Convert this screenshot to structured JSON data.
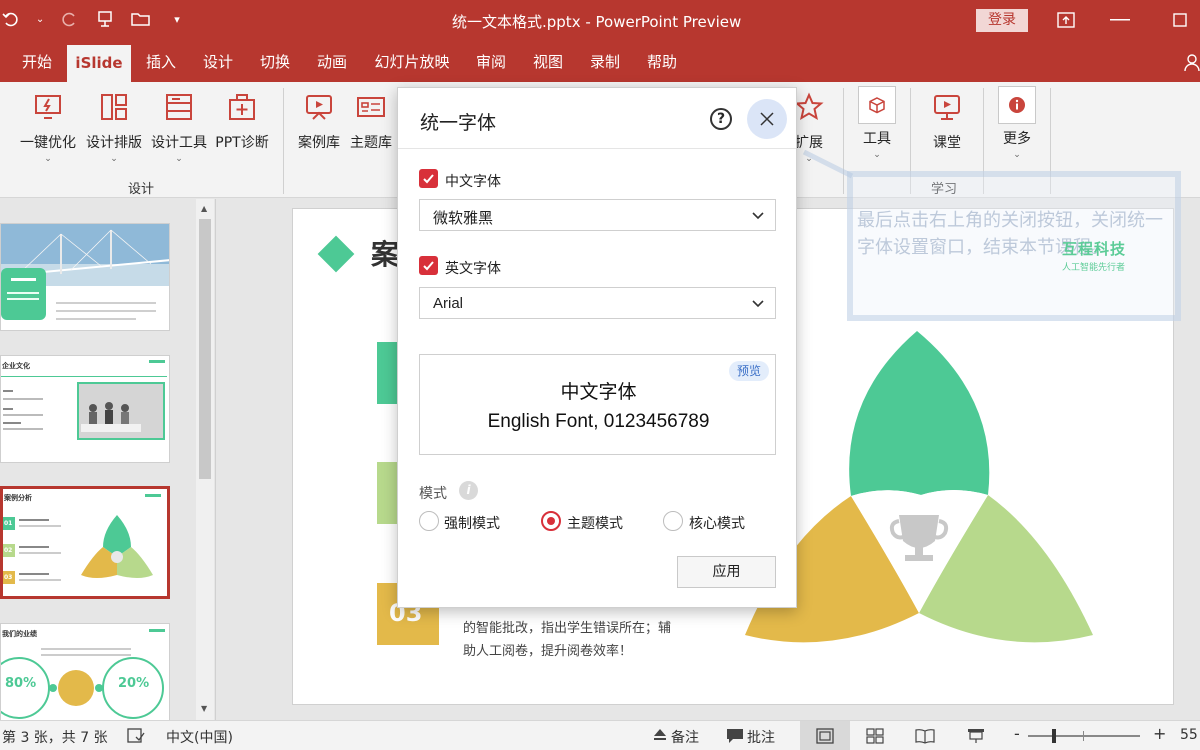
{
  "window": {
    "title": "统一文本格式.pptx  -  PowerPoint Preview",
    "login_label": "登录"
  },
  "menu": {
    "tabs": [
      "开始",
      "iSlide",
      "插入",
      "设计",
      "切换",
      "动画",
      "幻灯片放映",
      "审阅",
      "视图",
      "录制",
      "帮助"
    ],
    "active": "iSlide"
  },
  "ribbon": {
    "design_group": {
      "label": "设计",
      "buttons": [
        "一键优化",
        "设计排版",
        "设计工具",
        "PPT诊断"
      ]
    },
    "resource_buttons": [
      "案例库",
      "主题库"
    ],
    "extend_label": "扩展",
    "tools_label": "工具",
    "classroom_label": "课堂",
    "learn_group_label": "学习",
    "more_label": "更多"
  },
  "dialog": {
    "title": "统一字体",
    "help_symbol": "?",
    "chinese_font": {
      "label": "中文字体",
      "checked": true,
      "value": "微软雅黑"
    },
    "english_font": {
      "label": "英文字体",
      "checked": true,
      "value": "Arial"
    },
    "preview": {
      "badge": "预览",
      "chinese_sample": "中文字体",
      "english_sample": "English Font, 0123456789"
    },
    "mode": {
      "label": "模式",
      "info_symbol": "i",
      "options": [
        "强制模式",
        "主题模式",
        "核心模式"
      ],
      "selected": "主题模式"
    },
    "apply_label": "应用"
  },
  "annotation": {
    "text": "最后点击右上角的关闭按钮，关闭统一字体设置窗口，结束本节课程。"
  },
  "watermark": {
    "name": "互程科技",
    "slogan": "人工智能先行者"
  },
  "slide": {
    "title_partial": "案",
    "step3_number": "03",
    "step3_text_line1": "的智能批改，指出学生错误所在；辅",
    "step3_text_line2": "助人工阅卷，提升阅卷效率！",
    "colors": {
      "green": "#4dc995",
      "yellow": "#e3b94a",
      "lightgreen": "#b7d98c"
    }
  },
  "thumbnails": {
    "slide2_title": "企业文化",
    "slide3_title": "案例分析",
    "slide4_title": "我们的业绩",
    "slide4_stat_left": "80%",
    "slide4_stat_right": "20%",
    "slide3_steps": [
      "01",
      "02",
      "03"
    ]
  },
  "status": {
    "slide_counter": "第 3 张，共 7 张",
    "language": "中文(中国)",
    "notes_label": "备注",
    "comments_label": "批注",
    "zoom_minus": "-",
    "zoom_plus": "+",
    "zoom_value": "55"
  },
  "theme": {
    "accent": "#b7372f",
    "checkbox": "#d8303a"
  }
}
